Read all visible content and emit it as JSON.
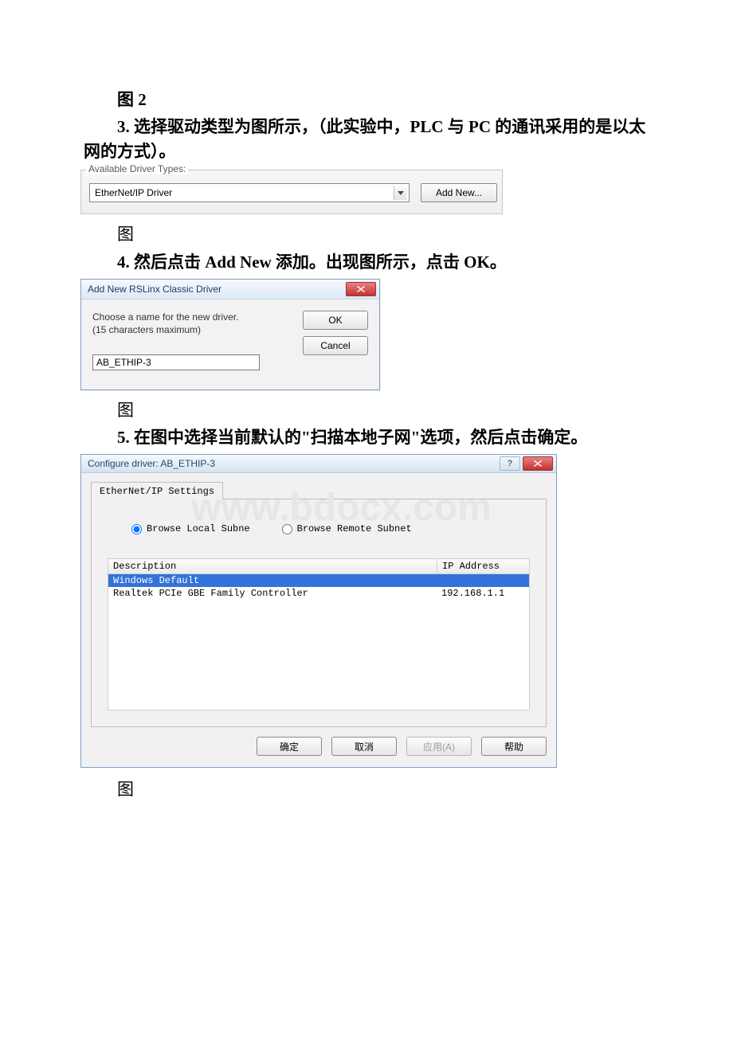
{
  "watermark": "www.bdocx.com",
  "headings": {
    "fig2": "图 2",
    "step3": "3. 选择驱动类型为图所示，（此实验中，PLC 与 PC 的通讯采用的是以太网的方式）。",
    "fig_a": "图",
    "step4": "4. 然后点击 Add New 添加。出现图所示，点击 OK。",
    "fig_b": "图",
    "step5": "5. 在图中选择当前默认的\"扫描本地子网\"选项，然后点击确定。",
    "fig_c": "图"
  },
  "driverTypes": {
    "legend": "Available Driver Types:",
    "selected": "EtherNet/IP Driver",
    "addNew": "Add New..."
  },
  "addNewDialog": {
    "title": "Add New RSLinx Classic Driver",
    "instruction1": "Choose a name for the new driver.",
    "instruction2": "(15 characters maximum)",
    "value": "AB_ETHIP-3",
    "ok": "OK",
    "cancel": "Cancel"
  },
  "configDialog": {
    "title": "Configure driver: AB_ETHIP-3",
    "tab": "EtherNet/IP Settings",
    "radio1": "Browse Local Subne",
    "radio2": "Browse Remote Subnet",
    "col_desc": "Description",
    "col_ip": "IP Address",
    "rows": [
      {
        "desc": "Windows Default",
        "ip": ""
      },
      {
        "desc": "Realtek PCIe GBE Family Controller",
        "ip": "192.168.1.1"
      }
    ],
    "ok": "确定",
    "cancel": "取消",
    "apply": "应用(A)",
    "help": "帮助"
  }
}
